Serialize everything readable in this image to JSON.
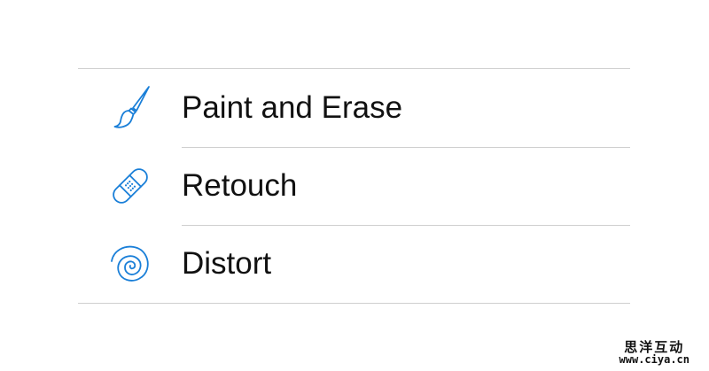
{
  "menu": {
    "items": [
      {
        "label": "Paint and Erase",
        "icon": "paintbrush-icon"
      },
      {
        "label": "Retouch",
        "icon": "bandage-icon"
      },
      {
        "label": "Distort",
        "icon": "spiral-icon"
      }
    ]
  },
  "watermark": {
    "title": "思洋互动",
    "url": "www.ciya.cn"
  },
  "colors": {
    "accent": "#1a7fd8",
    "text": "#111111",
    "divider": "#cfcfcf",
    "background": "#ffffff"
  }
}
